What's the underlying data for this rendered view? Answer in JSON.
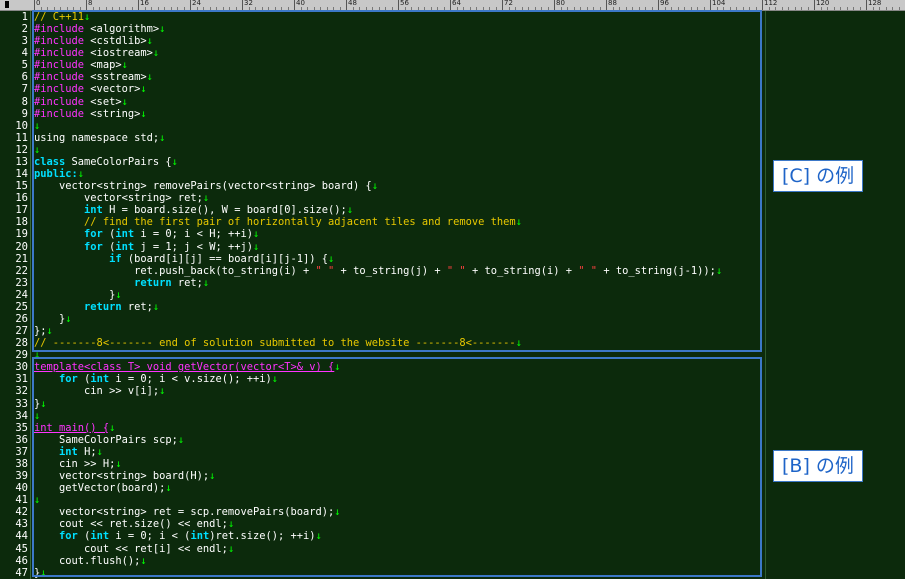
{
  "ruler": {
    "labels": [
      "0",
      "8",
      "16",
      "24",
      "32",
      "40",
      "48",
      "56",
      "64",
      "72",
      "80",
      "88",
      "96",
      "104",
      "112",
      "120",
      "128"
    ]
  },
  "lines": [
    {
      "n": "1",
      "seg": [
        {
          "c": "cm",
          "t": "// C++11"
        },
        {
          "c": "nl",
          "t": "↓"
        }
      ]
    },
    {
      "n": "2",
      "seg": [
        {
          "c": "kw-pp",
          "t": "#include"
        },
        {
          "c": "",
          "t": " <algorithm>"
        },
        {
          "c": "nl",
          "t": "↓"
        }
      ]
    },
    {
      "n": "3",
      "seg": [
        {
          "c": "kw-pp",
          "t": "#include"
        },
        {
          "c": "",
          "t": " <cstdlib>"
        },
        {
          "c": "nl",
          "t": "↓"
        }
      ]
    },
    {
      "n": "4",
      "seg": [
        {
          "c": "kw-pp",
          "t": "#include"
        },
        {
          "c": "",
          "t": " <iostream>"
        },
        {
          "c": "nl",
          "t": "↓"
        }
      ]
    },
    {
      "n": "5",
      "seg": [
        {
          "c": "kw-pp",
          "t": "#include"
        },
        {
          "c": "",
          "t": " <map>"
        },
        {
          "c": "nl",
          "t": "↓"
        }
      ]
    },
    {
      "n": "6",
      "seg": [
        {
          "c": "kw-pp",
          "t": "#include"
        },
        {
          "c": "",
          "t": " <sstream>"
        },
        {
          "c": "nl",
          "t": "↓"
        }
      ]
    },
    {
      "n": "7",
      "seg": [
        {
          "c": "kw-pp",
          "t": "#include"
        },
        {
          "c": "",
          "t": " <vector>"
        },
        {
          "c": "nl",
          "t": "↓"
        }
      ]
    },
    {
      "n": "8",
      "seg": [
        {
          "c": "kw-pp",
          "t": "#include"
        },
        {
          "c": "",
          "t": " <set>"
        },
        {
          "c": "nl",
          "t": "↓"
        }
      ]
    },
    {
      "n": "9",
      "seg": [
        {
          "c": "kw-pp",
          "t": "#include"
        },
        {
          "c": "",
          "t": " <string>"
        },
        {
          "c": "nl",
          "t": "↓"
        }
      ]
    },
    {
      "n": "10",
      "seg": [
        {
          "c": "nl",
          "t": "↓"
        }
      ]
    },
    {
      "n": "11",
      "seg": [
        {
          "c": "",
          "t": "using namespace std;"
        },
        {
          "c": "nl",
          "t": "↓"
        }
      ]
    },
    {
      "n": "12",
      "seg": [
        {
          "c": "nl",
          "t": "↓"
        }
      ]
    },
    {
      "n": "13",
      "seg": [
        {
          "c": "kw",
          "t": "class"
        },
        {
          "c": "",
          "t": " SameColorPairs {"
        },
        {
          "c": "nl",
          "t": "↓"
        }
      ]
    },
    {
      "n": "14",
      "seg": [
        {
          "c": "kw",
          "t": "public:"
        },
        {
          "c": "nl",
          "t": "↓"
        }
      ]
    },
    {
      "n": "15",
      "seg": [
        {
          "c": "",
          "t": "    vector<string> removePairs(vector<string> board) {"
        },
        {
          "c": "nl",
          "t": "↓"
        }
      ]
    },
    {
      "n": "16",
      "seg": [
        {
          "c": "",
          "t": "        vector<string> ret;"
        },
        {
          "c": "nl",
          "t": "↓"
        }
      ]
    },
    {
      "n": "17",
      "seg": [
        {
          "c": "",
          "t": "        "
        },
        {
          "c": "kw",
          "t": "int"
        },
        {
          "c": "",
          "t": " H = board.size(), W = board[0].size();"
        },
        {
          "c": "nl",
          "t": "↓"
        }
      ]
    },
    {
      "n": "18",
      "seg": [
        {
          "c": "",
          "t": "        "
        },
        {
          "c": "cm",
          "t": "// find the first pair of horizontally adjacent tiles and remove them"
        },
        {
          "c": "nl",
          "t": "↓"
        }
      ]
    },
    {
      "n": "19",
      "seg": [
        {
          "c": "",
          "t": "        "
        },
        {
          "c": "kw",
          "t": "for"
        },
        {
          "c": "",
          "t": " ("
        },
        {
          "c": "kw",
          "t": "int"
        },
        {
          "c": "",
          "t": " i = 0; i < H; ++i)"
        },
        {
          "c": "nl",
          "t": "↓"
        }
      ]
    },
    {
      "n": "20",
      "seg": [
        {
          "c": "",
          "t": "        "
        },
        {
          "c": "kw",
          "t": "for"
        },
        {
          "c": "",
          "t": " ("
        },
        {
          "c": "kw",
          "t": "int"
        },
        {
          "c": "",
          "t": " j = 1; j < W; ++j)"
        },
        {
          "c": "nl",
          "t": "↓"
        }
      ]
    },
    {
      "n": "21",
      "seg": [
        {
          "c": "",
          "t": "            "
        },
        {
          "c": "kw",
          "t": "if"
        },
        {
          "c": "",
          "t": " (board[i][j] == board[i][j-1]) {"
        },
        {
          "c": "nl",
          "t": "↓"
        }
      ]
    },
    {
      "n": "22",
      "seg": [
        {
          "c": "",
          "t": "                ret.push_back(to_string(i) + "
        },
        {
          "c": "str",
          "t": "\" \""
        },
        {
          "c": "",
          "t": " + to_string(j) + "
        },
        {
          "c": "str",
          "t": "\" \""
        },
        {
          "c": "",
          "t": " + to_string(i) + "
        },
        {
          "c": "str",
          "t": "\" \""
        },
        {
          "c": "",
          "t": " + to_string(j-1));"
        },
        {
          "c": "nl",
          "t": "↓"
        }
      ]
    },
    {
      "n": "23",
      "seg": [
        {
          "c": "",
          "t": "                "
        },
        {
          "c": "kw",
          "t": "return"
        },
        {
          "c": "",
          "t": " ret;"
        },
        {
          "c": "nl",
          "t": "↓"
        }
      ]
    },
    {
      "n": "24",
      "seg": [
        {
          "c": "",
          "t": "            }"
        },
        {
          "c": "nl",
          "t": "↓"
        }
      ]
    },
    {
      "n": "25",
      "seg": [
        {
          "c": "",
          "t": "        "
        },
        {
          "c": "kw",
          "t": "return"
        },
        {
          "c": "",
          "t": " ret;"
        },
        {
          "c": "nl",
          "t": "↓"
        }
      ]
    },
    {
      "n": "26",
      "seg": [
        {
          "c": "",
          "t": "    }"
        },
        {
          "c": "nl",
          "t": "↓"
        }
      ]
    },
    {
      "n": "27",
      "seg": [
        {
          "c": "",
          "t": "};"
        },
        {
          "c": "nl",
          "t": "↓"
        }
      ]
    },
    {
      "n": "28",
      "seg": [
        {
          "c": "cm",
          "t": "// -------8<------- end of solution submitted to the website -------8<-------"
        },
        {
          "c": "nl",
          "t": "↓"
        }
      ]
    },
    {
      "n": "29",
      "seg": [
        {
          "c": "nl",
          "t": "↓"
        }
      ]
    },
    {
      "n": "30",
      "seg": [
        {
          "c": "kw-pp ul",
          "t": "template<class T> void getVector(vector<T>& v) {"
        },
        {
          "c": "nl",
          "t": "↓"
        }
      ]
    },
    {
      "n": "31",
      "seg": [
        {
          "c": "",
          "t": "    "
        },
        {
          "c": "kw",
          "t": "for"
        },
        {
          "c": "",
          "t": " ("
        },
        {
          "c": "kw",
          "t": "int"
        },
        {
          "c": "",
          "t": " i = 0; i < v.size(); ++i)"
        },
        {
          "c": "nl",
          "t": "↓"
        }
      ]
    },
    {
      "n": "32",
      "seg": [
        {
          "c": "",
          "t": "        cin >> v[i];"
        },
        {
          "c": "nl",
          "t": "↓"
        }
      ]
    },
    {
      "n": "33",
      "seg": [
        {
          "c": "",
          "t": "}"
        },
        {
          "c": "nl",
          "t": "↓"
        }
      ]
    },
    {
      "n": "34",
      "seg": [
        {
          "c": "nl",
          "t": "↓"
        }
      ]
    },
    {
      "n": "35",
      "seg": [
        {
          "c": "kw-pp ul",
          "t": "int main() {"
        },
        {
          "c": "nl",
          "t": "↓"
        }
      ]
    },
    {
      "n": "36",
      "seg": [
        {
          "c": "",
          "t": "    SameColorPairs scp;"
        },
        {
          "c": "nl",
          "t": "↓"
        }
      ]
    },
    {
      "n": "37",
      "seg": [
        {
          "c": "",
          "t": "    "
        },
        {
          "c": "kw",
          "t": "int"
        },
        {
          "c": "",
          "t": " H;"
        },
        {
          "c": "nl",
          "t": "↓"
        }
      ]
    },
    {
      "n": "38",
      "seg": [
        {
          "c": "",
          "t": "    cin >> H;"
        },
        {
          "c": "nl",
          "t": "↓"
        }
      ]
    },
    {
      "n": "39",
      "seg": [
        {
          "c": "",
          "t": "    vector<string> board(H);"
        },
        {
          "c": "nl",
          "t": "↓"
        }
      ]
    },
    {
      "n": "40",
      "seg": [
        {
          "c": "",
          "t": "    getVector(board);"
        },
        {
          "c": "nl",
          "t": "↓"
        }
      ]
    },
    {
      "n": "41",
      "seg": [
        {
          "c": "nl",
          "t": "↓"
        }
      ]
    },
    {
      "n": "42",
      "seg": [
        {
          "c": "",
          "t": "    vector<string> ret = scp.removePairs(board);"
        },
        {
          "c": "nl",
          "t": "↓"
        }
      ]
    },
    {
      "n": "43",
      "seg": [
        {
          "c": "",
          "t": "    cout << ret.size() << endl;"
        },
        {
          "c": "nl",
          "t": "↓"
        }
      ]
    },
    {
      "n": "44",
      "seg": [
        {
          "c": "",
          "t": "    "
        },
        {
          "c": "kw",
          "t": "for"
        },
        {
          "c": "",
          "t": " ("
        },
        {
          "c": "kw",
          "t": "int"
        },
        {
          "c": "",
          "t": " i = 0; i < ("
        },
        {
          "c": "kw",
          "t": "int"
        },
        {
          "c": "",
          "t": ")ret.size(); ++i)"
        },
        {
          "c": "nl",
          "t": "↓"
        }
      ]
    },
    {
      "n": "45",
      "seg": [
        {
          "c": "",
          "t": "        cout << ret[i] << endl;"
        },
        {
          "c": "nl",
          "t": "↓"
        }
      ]
    },
    {
      "n": "46",
      "seg": [
        {
          "c": "",
          "t": "    cout.flush();"
        },
        {
          "c": "nl",
          "t": "↓"
        }
      ]
    },
    {
      "n": "47",
      "seg": [
        {
          "c": "",
          "t": "}"
        },
        {
          "c": "nl",
          "t": "↓"
        }
      ]
    }
  ],
  "annotations": {
    "c_label": "[C] の例",
    "b_label": "[B] の例"
  },
  "colors": {
    "background": "#0c2a0c",
    "preprocessor": "#ff33ff",
    "keyword": "#00e0ff",
    "comment": "#e8c800",
    "string": "#ff4040",
    "newline_marker": "#00ff00",
    "annotation_border": "#3c78c8"
  }
}
